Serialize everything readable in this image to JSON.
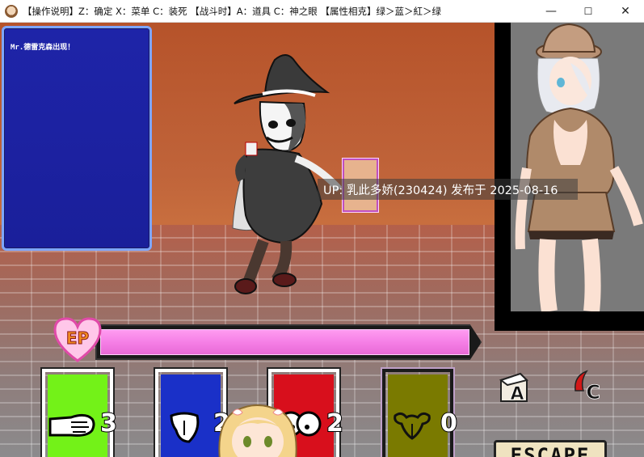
{
  "window": {
    "title": "【操作说明】Z：确定 X：菜单 C：装死 【战斗时】A：道具 C：神之眼 【属性相克】绿＞蓝＞紅＞绿",
    "controls": {
      "minimize": "—",
      "maximize": "☐",
      "close": "✕"
    }
  },
  "message": {
    "text": "Mr.德雷克森出现！"
  },
  "watermark": {
    "text": "UP: 乳此多娇(230424) 发布于 2025-08-16"
  },
  "ep": {
    "label": "EP",
    "level_fraction": 0.98
  },
  "cards": [
    {
      "id": "green",
      "color": "#73f218",
      "icon": "hand-rock-icon",
      "count": "3"
    },
    {
      "id": "blue",
      "color": "#1a30c8",
      "icon": "tongue-icon",
      "count": "2"
    },
    {
      "id": "red",
      "color": "#d80f1c",
      "icon": "chest-icon",
      "count": "2"
    },
    {
      "id": "olive",
      "color": "#7a7a00",
      "icon": "uterus-icon",
      "count": "0"
    }
  ],
  "keys": {
    "a": "A",
    "c": "C"
  },
  "escape": {
    "label": "ESCAPE"
  }
}
